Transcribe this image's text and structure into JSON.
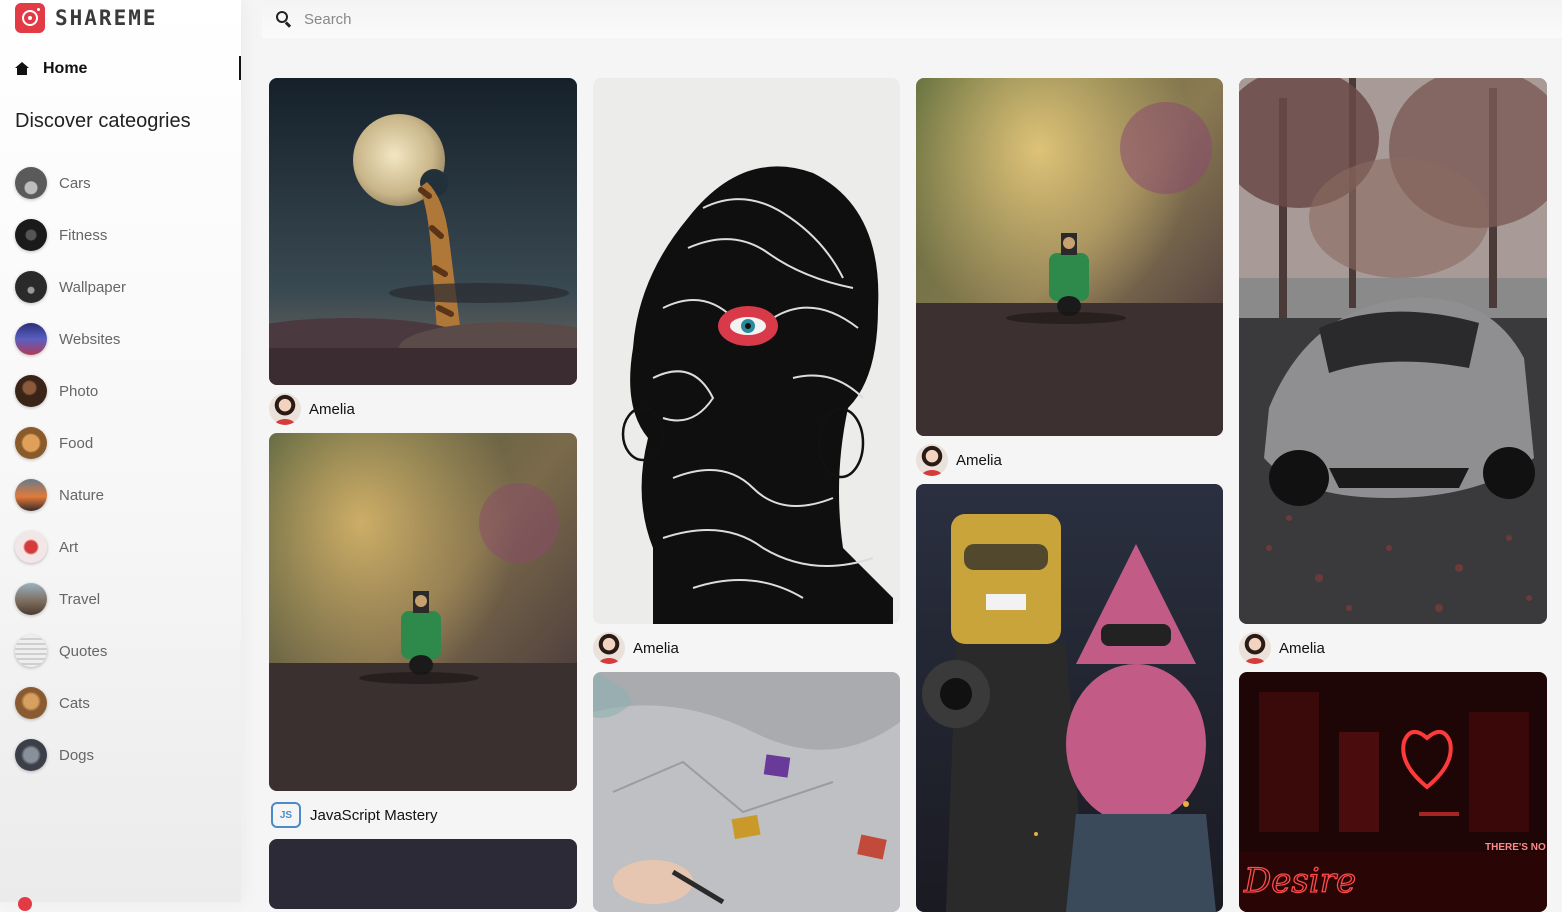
{
  "app": {
    "logo_text": "SHAREME"
  },
  "search": {
    "placeholder": "Search",
    "value": ""
  },
  "sidebar": {
    "home_label": "Home",
    "discover_heading": "Discover cateogries",
    "categories": [
      {
        "label": "Cars",
        "thumb_color": "#6d6d6d"
      },
      {
        "label": "Fitness",
        "thumb_color": "#2b2b2b"
      },
      {
        "label": "Wallpaper",
        "thumb_color": "#3b3b3b"
      },
      {
        "label": "Websites",
        "thumb_color": "#3a3f8a"
      },
      {
        "label": "Photo",
        "thumb_color": "#5a3a2a"
      },
      {
        "label": "Food",
        "thumb_color": "#b07a3c"
      },
      {
        "label": "Nature",
        "thumb_color": "#c2633b"
      },
      {
        "label": "Art",
        "thumb_color": "#d24a4a"
      },
      {
        "label": "Travel",
        "thumb_color": "#8a7a6a"
      },
      {
        "label": "Quotes",
        "thumb_color": "#d9d9d9"
      },
      {
        "label": "Cats",
        "thumb_color": "#b8844a"
      },
      {
        "label": "Dogs",
        "thumb_color": "#5d6470"
      }
    ]
  },
  "pins": {
    "col1": [
      {
        "author": "Amelia",
        "image": "giraffe-moon"
      },
      {
        "author": "JavaScript Mastery",
        "author_badge": "JS",
        "image": "green-scooter"
      },
      {
        "image": "dark"
      }
    ],
    "col2": [
      {
        "author": "Amelia",
        "image": "line-art-face"
      },
      {
        "image": "paint-pans"
      }
    ],
    "col3": [
      {
        "author": "Amelia",
        "image": "green-scooter"
      },
      {
        "image": "spongebob-patrick"
      }
    ],
    "col4": [
      {
        "author": "Amelia",
        "image": "grey-lamborghini"
      },
      {
        "image": "neon-desire"
      }
    ]
  },
  "neon": {
    "script": "Desire",
    "sign": "THERE'S NO ESCAPE"
  }
}
